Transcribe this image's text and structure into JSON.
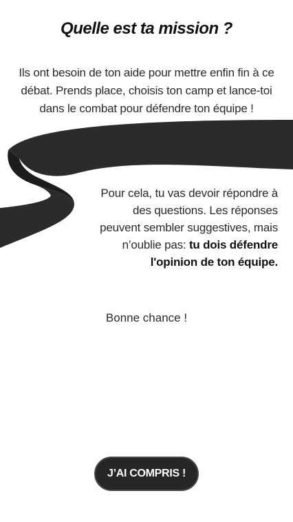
{
  "mission": {
    "title": "Quelle est ta mission ?",
    "intro": "Ils ont besoin de ton aide pour mettre enfin fin à ce débat. Prends place, choisis ton camp et lance-toi dans le combat pour défendre ton équipe !",
    "questions_text": "Pour cela, tu vas devoir répondre à des questions. Les réponses peuvent sembler suggestives, mais n’oublie pas: ",
    "questions_emphasis": "tu dois défendre l'opinion de ton équipe.",
    "good_luck": "Bonne chance !",
    "button_label": "J’AI COMPRIS !"
  },
  "colors": {
    "ribbon_dark": "#2a2a2a",
    "ribbon_shadow": "#1a1a1a",
    "button_bg": "#262626",
    "button_text": "#ffffff"
  }
}
